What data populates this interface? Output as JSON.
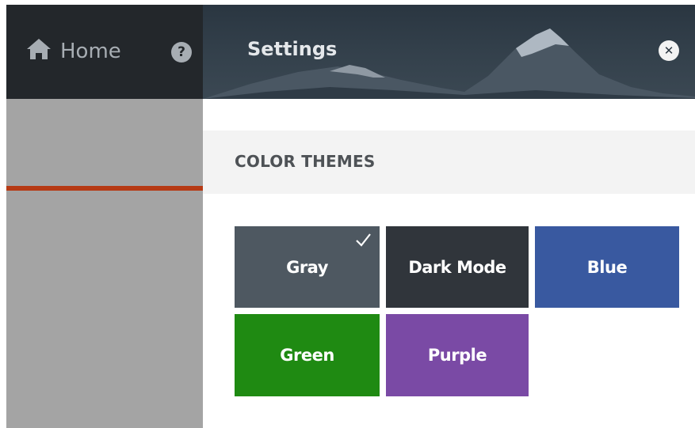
{
  "nav": {
    "home_label": "Home",
    "home_icon": "home-icon",
    "help_icon": "help-icon",
    "help_glyph": "?"
  },
  "panel": {
    "title": "Settings",
    "close_icon": "close-icon",
    "close_glyph": "✕"
  },
  "color_themes": {
    "heading": "COLOR THEMES",
    "selected": "Gray",
    "themes": [
      {
        "label": "Gray",
        "color": "#4e5861",
        "selected": true
      },
      {
        "label": "Dark Mode",
        "color": "#30353b",
        "selected": false
      },
      {
        "label": "Blue",
        "color": "#3959a0",
        "selected": false
      },
      {
        "label": "Green",
        "color": "#1f8a12",
        "selected": false
      },
      {
        "label": "Purple",
        "color": "#7a4aa5",
        "selected": false
      }
    ]
  },
  "colors": {
    "accent_line": "#b63a14",
    "left_header_bg": "#23272b",
    "left_content_bg": "#a4a4a4"
  }
}
